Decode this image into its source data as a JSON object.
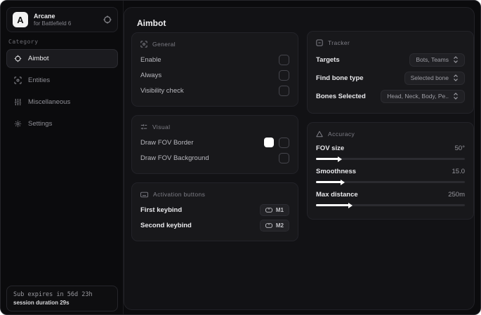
{
  "colors": {
    "accent": "#ffffff",
    "panel_bg": "#121215",
    "card_bg": "#18181b"
  },
  "app": {
    "logo_letter": "A",
    "name": "Arcane",
    "subtitle": "for Battlefield 6"
  },
  "sidebar": {
    "category_label": "Category",
    "items": [
      {
        "label": "Aimbot",
        "active": true
      },
      {
        "label": "Entities",
        "active": false
      },
      {
        "label": "Miscellaneous",
        "active": false
      },
      {
        "label": "Settings",
        "active": false
      }
    ],
    "footer": {
      "line1": "Sub expires in 56d 23h",
      "line2": "session duration 29s"
    }
  },
  "main": {
    "title": "Aimbot",
    "general": {
      "title": "General",
      "rows": [
        {
          "label": "Enable",
          "checked": false
        },
        {
          "label": "Always",
          "checked": false
        },
        {
          "label": "Visibility check",
          "checked": false
        }
      ]
    },
    "visual": {
      "title": "Visual",
      "rows": [
        {
          "label": "Draw FOV Border",
          "checked": false,
          "swatch": "#ffffff"
        },
        {
          "label": "Draw FOV Background",
          "checked": false
        }
      ]
    },
    "activation": {
      "title": "Activation buttons",
      "rows": [
        {
          "label": "First keybind",
          "key": "M1"
        },
        {
          "label": "Second keybind",
          "key": "M2"
        }
      ]
    },
    "tracker": {
      "title": "Tracker",
      "rows": [
        {
          "label": "Targets",
          "value": "Bots, Teams"
        },
        {
          "label": "Find bone type",
          "value": "Selected bone"
        },
        {
          "label": "Bones Selected",
          "value": "Head, Neck, Body, Pe.."
        }
      ]
    },
    "accuracy": {
      "title": "Accuracy",
      "rows": [
        {
          "label": "FOV size",
          "value": "50°",
          "fill_pct": 15
        },
        {
          "label": "Smoothness",
          "value": "15.0",
          "fill_pct": 17
        },
        {
          "label": "Max distance",
          "value": "250m",
          "fill_pct": 22
        }
      ]
    }
  }
}
